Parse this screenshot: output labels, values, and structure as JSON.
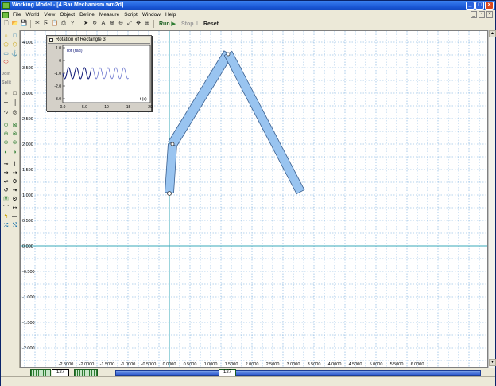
{
  "window": {
    "title": "Working Model - [4 Bar Mechanism.wm2d]"
  },
  "menu": [
    "File",
    "World",
    "View",
    "Object",
    "Define",
    "Measure",
    "Script",
    "Window",
    "Help"
  ],
  "toolbar": {
    "run": "Run",
    "stop": "Stop",
    "reset": "Reset"
  },
  "palette": {
    "join": "Join",
    "split": "Split"
  },
  "meter": {
    "title": "Rotation of Rectangle 3",
    "ylabel": "rot (rad)",
    "xlabel": "t (s)",
    "yticks": [
      "1.0",
      "0",
      "-1.0",
      "-2.0",
      "-3.0"
    ],
    "xticks": [
      "0.0",
      "5.0",
      "10",
      "15",
      "20"
    ]
  },
  "canvas": {
    "xticks": [
      "-2.5000",
      "-2.0000",
      "-1.5000",
      "-1.0000",
      "-0.5000",
      "0.0000",
      "0.5000",
      "1.0000",
      "1.5000",
      "2.0000",
      "2.5000",
      "3.0000",
      "3.5000",
      "4.0000",
      "4.5000",
      "5.0000",
      "5.5000",
      "6.0000"
    ],
    "yticks": [
      "4.000",
      "3.500",
      "3.000",
      "2.500",
      "2.000",
      "1.500",
      "1.000",
      "0.500",
      "0.000",
      "-0.500",
      "-1.000",
      "-1.500",
      "-2.000"
    ]
  },
  "frame_counter": {
    "left": "127",
    "right": "127"
  },
  "colors": {
    "body_fill": "#99c4f0",
    "body_stroke": "#3a5f8f",
    "grid": "#6fa8dc",
    "axis": "#3aa8b8",
    "graph_line": "#1a237e"
  }
}
